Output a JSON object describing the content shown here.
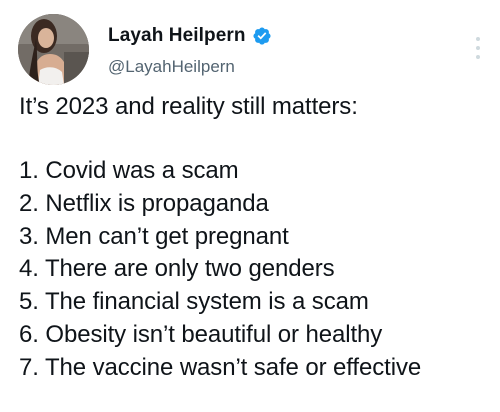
{
  "author": {
    "display_name": "Layah Heilpern",
    "handle": "@LayahHeilpern",
    "verified_icon": "verified-badge-icon",
    "verified_color": "#1d9bf0"
  },
  "menu": {
    "icon": "more-vertical-icon"
  },
  "tweet": {
    "intro": "It’s 2023 and reality still matters:",
    "items": [
      "1. Covid was a scam",
      "2. Netflix is propaganda",
      "3. Men can’t get pregnant",
      "4. There are only two genders",
      "5. The financial system is a scam",
      "6. Obesity isn’t beautiful or healthy",
      "7. The vaccine wasn’t safe or effective"
    ]
  },
  "colors": {
    "text": "#0f1419",
    "secondary_text": "#536471",
    "background": "#ffffff"
  }
}
